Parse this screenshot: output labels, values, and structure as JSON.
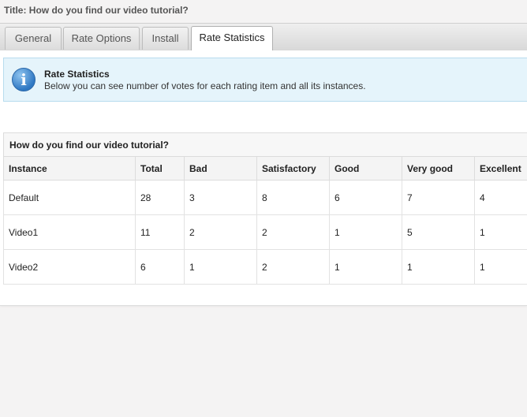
{
  "page": {
    "title_line": "Title: How do you find our video tutorial?"
  },
  "tabs": [
    {
      "label": "General",
      "active": false
    },
    {
      "label": "Rate Options",
      "active": false
    },
    {
      "label": "Install",
      "active": false
    },
    {
      "label": "Rate Statistics",
      "active": true
    }
  ],
  "info": {
    "icon": "info-icon",
    "title": "Rate Statistics",
    "text": "Below you can see number of votes for each rating item and all its instances."
  },
  "table": {
    "caption": "How do you find our video tutorial?",
    "columns": [
      "Instance",
      "Total",
      "Bad",
      "Satisfactory",
      "Good",
      "Very good",
      "Excellent"
    ],
    "rows": [
      [
        "Default",
        "28",
        "3",
        "8",
        "6",
        "7",
        "4"
      ],
      [
        "Video1",
        "11",
        "2",
        "2",
        "1",
        "5",
        "1"
      ],
      [
        "Video2",
        "6",
        "1",
        "2",
        "1",
        "1",
        "1"
      ]
    ]
  }
}
